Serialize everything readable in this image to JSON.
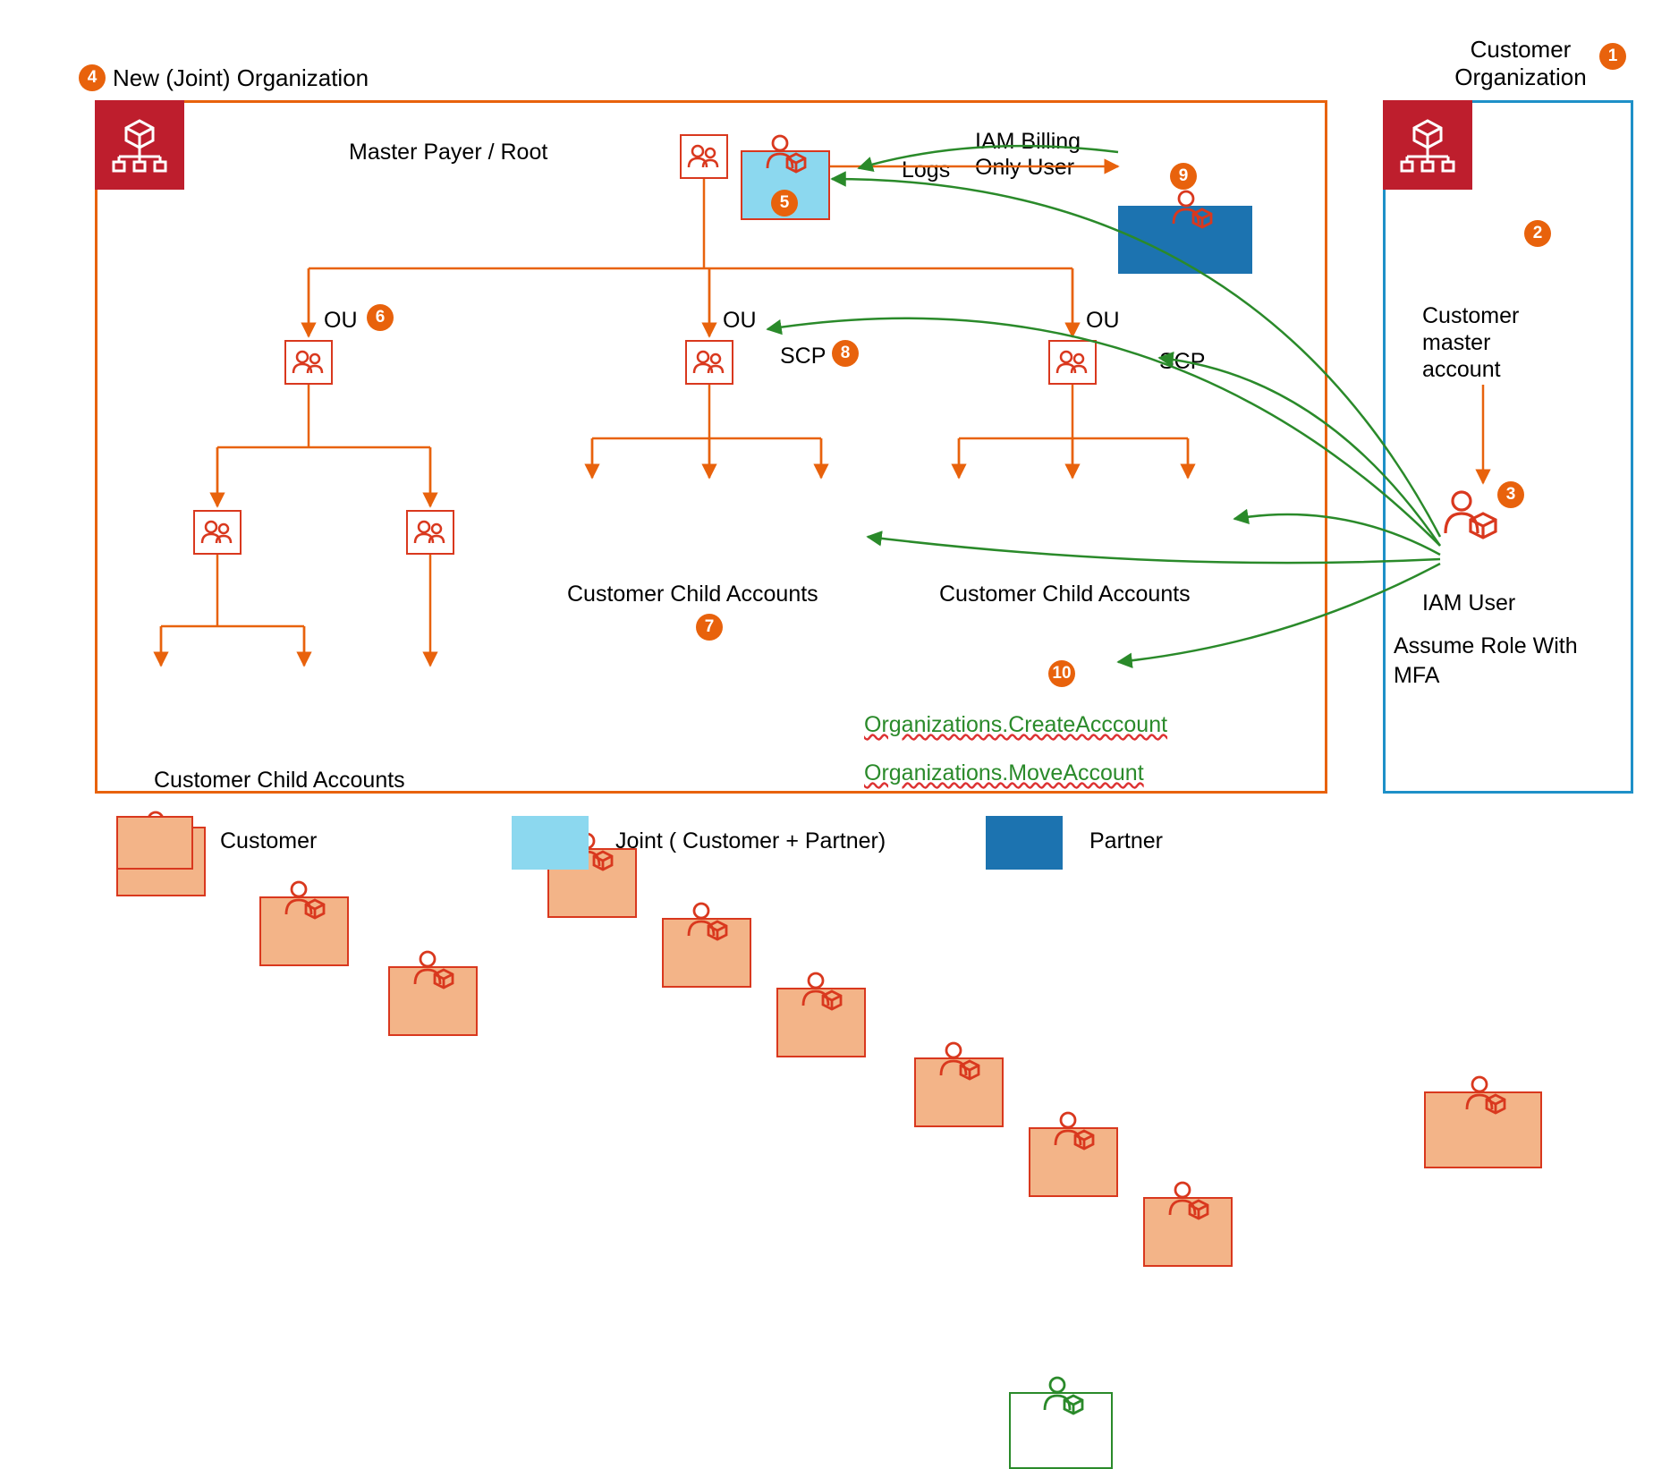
{
  "titles": {
    "newOrg": "New (Joint) Organization",
    "custOrg": "Customer\nOrganization"
  },
  "labels": {
    "masterPayer": "Master Payer / Root",
    "logs": "Logs",
    "iamBilling": "IAM Billing\nOnly User",
    "ou1": "OU",
    "ou2": "OU",
    "ou3": "OU",
    "scp1": "SCP",
    "scp2": "SCP",
    "childA": "Customer Child  Accounts",
    "childB": "Customer Child  Accounts",
    "childC": "Customer Child  Accounts",
    "custMaster": "Customer master account",
    "iamUser": "IAM User",
    "assumeRole": "Assume Role With MFA",
    "api1": "Organizations.CreateAcccount",
    "api2": "Organizations.MoveAccount"
  },
  "legend": {
    "customer": "Customer",
    "joint": "Joint ( Customer + Partner)",
    "partner": "Partner"
  },
  "badges": {
    "b1": "1",
    "b2": "2",
    "b3": "3",
    "b4": "4",
    "b5": "5",
    "b6": "6",
    "b7": "7",
    "b8": "8",
    "b9": "9",
    "b10": "10"
  }
}
